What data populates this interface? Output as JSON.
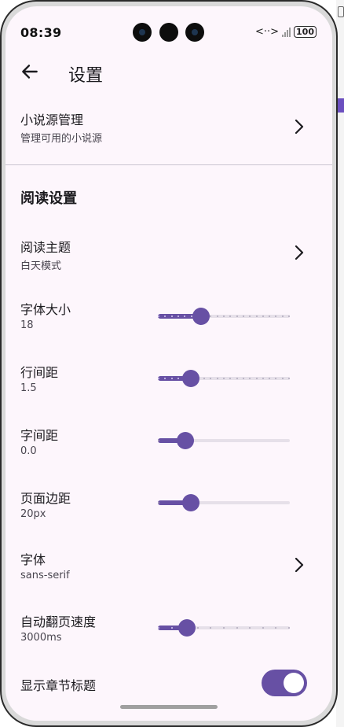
{
  "status": {
    "time": "08:39",
    "battery": "100",
    "net": "<··>"
  },
  "appbar": {
    "title": "设置"
  },
  "source": {
    "title": "小说源管理",
    "subtitle": "管理可用的小说源"
  },
  "section": {
    "title": "阅读设置"
  },
  "theme": {
    "title": "阅读主题",
    "subtitle": "白天模式"
  },
  "font_size": {
    "title": "字体大小",
    "value": "18",
    "level": 0.33,
    "ticks": 20
  },
  "line_spacing": {
    "title": "行间距",
    "value": "1.5",
    "level": 0.25,
    "ticks": 20
  },
  "letter_spacing": {
    "title": "字间距",
    "value": "0.0",
    "level": 0.21,
    "ticks": 0
  },
  "page_margin": {
    "title": "页面边距",
    "value": "20px",
    "level": 0.25,
    "ticks": 0
  },
  "font": {
    "title": "字体",
    "subtitle": "sans-serif"
  },
  "auto_page": {
    "title": "自动翻页速度",
    "value": "3000ms",
    "level": 0.22,
    "ticks": 10
  },
  "chapter_title": {
    "title": "显示章节标题",
    "enabled": true
  },
  "colors": {
    "primary": "#6750a4",
    "background": "#fdf6fc"
  }
}
